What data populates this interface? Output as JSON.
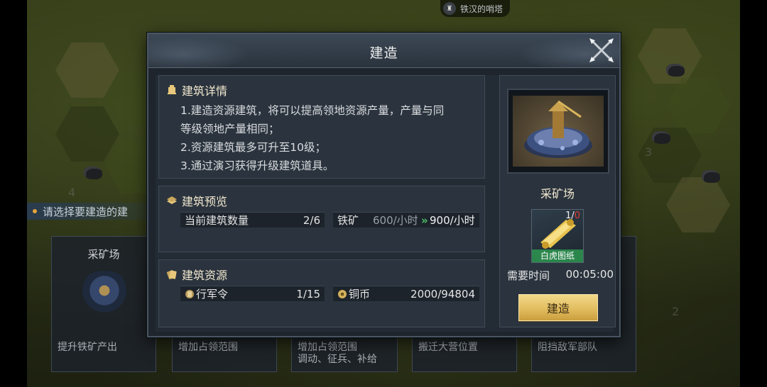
{
  "map": {
    "location_tag": "铁汉的哨塔",
    "select_hint": "请选择要建造的建",
    "hex_numbers": [
      "3",
      "4",
      "2",
      "3"
    ]
  },
  "cards": [
    {
      "name": "采矿场",
      "desc": "提升铁矿产出"
    },
    {
      "name": "",
      "desc": "增加占领范围"
    },
    {
      "name": "",
      "desc": "增加占领范围\n调动、征兵、补给"
    },
    {
      "name": "",
      "desc": "搬迁大营位置"
    },
    {
      "name": "",
      "desc": "阻挡敌军部队"
    }
  ],
  "dialog": {
    "title": "建造",
    "details": {
      "title": "建筑详情",
      "lines": [
        "1.建造资源建筑，将可以提高领地资源产量，产量与同",
        "等级领地产量相同；",
        "2.资源建筑最多可升至10级；",
        "3.通过演习获得升级建筑道具。"
      ]
    },
    "preview": {
      "title": "建筑预览",
      "count_label": "当前建筑数量",
      "count_value": "2/6",
      "resource_label": "铁矿",
      "current_rate": "600/小时",
      "arrow": "»",
      "next_rate": "900/小时"
    },
    "resources": {
      "title": "建筑资源",
      "order_label": "行军令",
      "order_value": "1/15",
      "copper_label": "铜币",
      "copper_value": "2000/94804"
    },
    "building": {
      "name": "采矿场",
      "item_count_have": "1/",
      "item_count_need": "0",
      "item_name": "白虎图纸",
      "time_label": "需要时间",
      "time_value": "00:05:00",
      "build_button": "建造"
    }
  },
  "colors": {
    "accent_gold": "#e2bd5f",
    "dialog_bg": "#1e252d",
    "title_text": "#f1e7cf",
    "rate_green": "#4fc36a",
    "shortage_red": "#e23a2f"
  }
}
